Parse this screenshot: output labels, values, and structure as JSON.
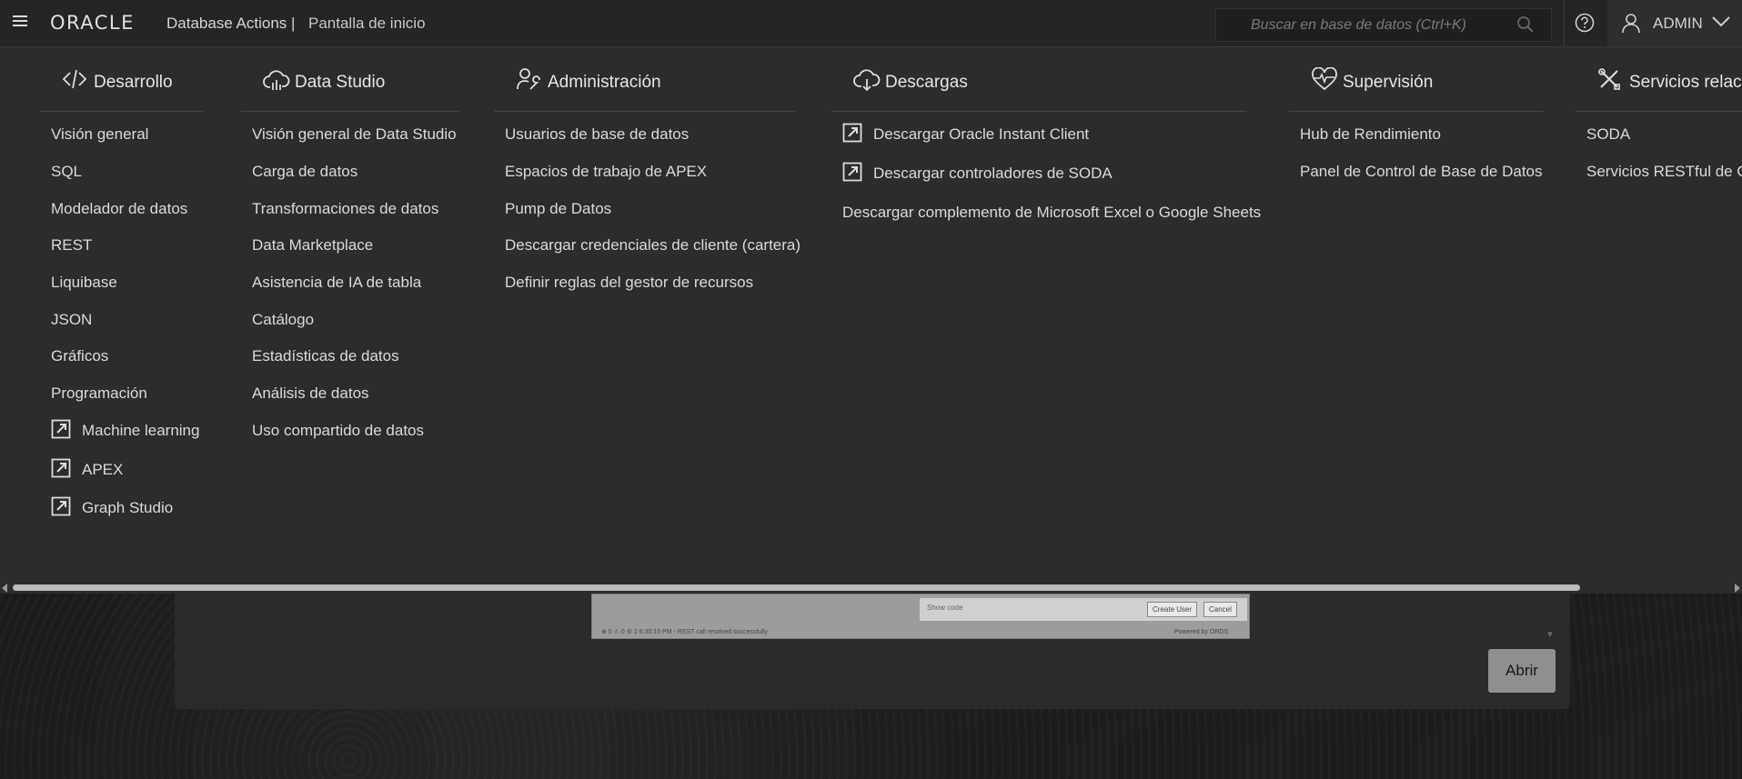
{
  "header": {
    "brand": "ORACLE",
    "app_name": "Database Actions |",
    "page_name": "Pantalla de inicio",
    "search_placeholder": "Buscar en base de datos (Ctrl+K)",
    "user": "ADMIN"
  },
  "menu": {
    "development": {
      "title": "Desarrollo",
      "items": [
        "Visión general",
        "SQL",
        "Modelador de datos",
        "REST",
        "Liquibase",
        "JSON",
        "Gráficos",
        "Programación",
        "Machine learning",
        "APEX",
        "Graph Studio"
      ]
    },
    "data_studio": {
      "title": "Data Studio",
      "items": [
        "Visión general de Data Studio",
        "Carga de datos",
        "Transformaciones de datos",
        "Data Marketplace",
        "Asistencia de IA de tabla",
        "Catálogo",
        "Estadísticas de datos",
        "Análisis de datos",
        "Uso compartido de datos"
      ]
    },
    "administration": {
      "title": "Administración",
      "items": [
        "Usuarios de base de datos",
        "Espacios de trabajo de APEX",
        "Pump de Datos",
        "Descargar credenciales de cliente (cartera)",
        "Definir reglas del gestor de recursos"
      ]
    },
    "downloads": {
      "title": "Descargas",
      "items": [
        "Descargar Oracle Instant Client",
        "Descargar controladores de SODA",
        "Descargar complemento de Microsoft Excel o Google Sheets"
      ]
    },
    "monitoring": {
      "title": "Supervisión",
      "items": [
        "Hub de Rendimiento",
        "Panel de Control de Base de Datos"
      ]
    },
    "related": {
      "title": "Servicios relaci",
      "items": [
        "SODA",
        "Servicios RESTful de Ora"
      ]
    }
  },
  "background": {
    "open_button": "Abrir",
    "preview": {
      "show_code": "Show code",
      "create_user": "Create User",
      "cancel": "Cancel",
      "status": "⊗ 0 ⚠ 0 ⚙ 1   6:30:15 PM - REST call resolved successfully",
      "powered": "Powered by ORDS"
    }
  }
}
